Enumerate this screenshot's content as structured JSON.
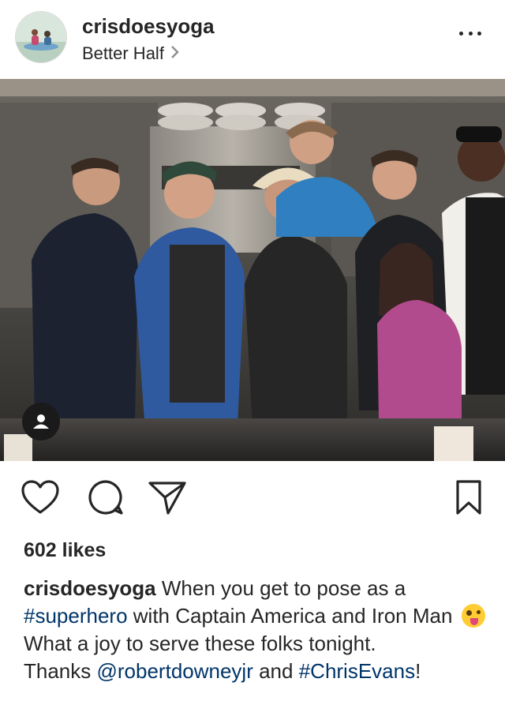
{
  "post": {
    "username": "crisdoesyoga",
    "location": "Better Half",
    "likes": "602 likes",
    "caption": {
      "username": "crisdoesyoga",
      "part1": " When you get to pose as a ",
      "hashtag1": "#superhero",
      "part2": " with Captain America and Iron Man ",
      "line2": "What a joy to serve these folks tonight.",
      "thanks": "Thanks ",
      "mention": "@robertdowneyjr",
      "and": " and ",
      "hashtag2": "#ChrisEvans",
      "end": "!"
    }
  },
  "icons": {
    "more": "more-options-icon",
    "location_arrow": "chevron-right-icon",
    "like": "heart-icon",
    "comment": "comment-icon",
    "share": "send-icon",
    "save": "bookmark-icon",
    "user_tag": "person-icon"
  },
  "colors": {
    "text": "#262626",
    "secondary": "#8e8e8e",
    "link": "#003569"
  }
}
